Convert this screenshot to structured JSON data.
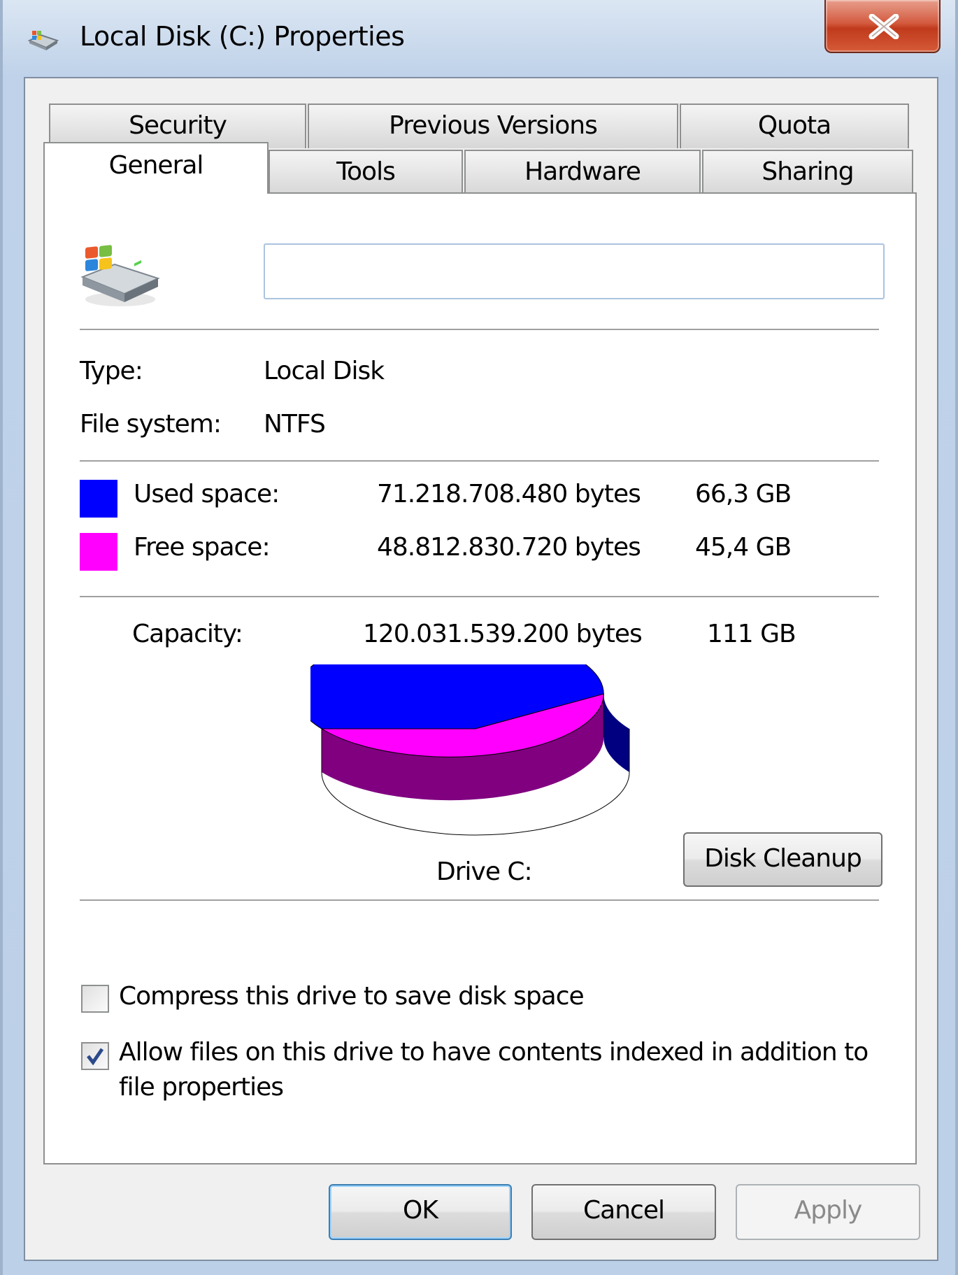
{
  "window": {
    "title": "Local Disk (C:) Properties",
    "close_label": "close"
  },
  "tabs": {
    "row_back": [
      "Security",
      "Previous Versions",
      "Quota"
    ],
    "row_front": [
      "General",
      "Tools",
      "Hardware",
      "Sharing"
    ],
    "active": "General"
  },
  "general": {
    "name_field_value": "",
    "type_label": "Type:",
    "type_value": "Local Disk",
    "fs_label": "File system:",
    "fs_value": "NTFS",
    "used_label": "Used space:",
    "used_bytes": "71.218.708.480 bytes",
    "used_gb": "66,3 GB",
    "free_label": "Free space:",
    "free_bytes": "48.812.830.720 bytes",
    "free_gb": "45,4 GB",
    "capacity_label": "Capacity:",
    "capacity_bytes": "120.031.539.200 bytes",
    "capacity_gb": "111 GB",
    "drive_label": "Drive C:",
    "disk_cleanup_label": "Disk Cleanup",
    "compress_label": "Compress this drive to save disk space",
    "compress_checked": false,
    "index_label_line1": "Allow files on this drive to have contents indexed in addition to",
    "index_label_line2": "file properties",
    "index_checked": true
  },
  "colors": {
    "used": "#0000ff",
    "used_side": "#000080",
    "free": "#ff00ff",
    "free_side": "#800080"
  },
  "chart_data": {
    "type": "pie",
    "categories": [
      "Used space",
      "Free space"
    ],
    "values": [
      71218708480,
      48812830720
    ],
    "title": "Drive C:"
  },
  "footer": {
    "ok_label": "OK",
    "cancel_label": "Cancel",
    "apply_label": "Apply"
  },
  "icons": {
    "title": "drive-icon",
    "drive": "windows-drive-icon"
  }
}
